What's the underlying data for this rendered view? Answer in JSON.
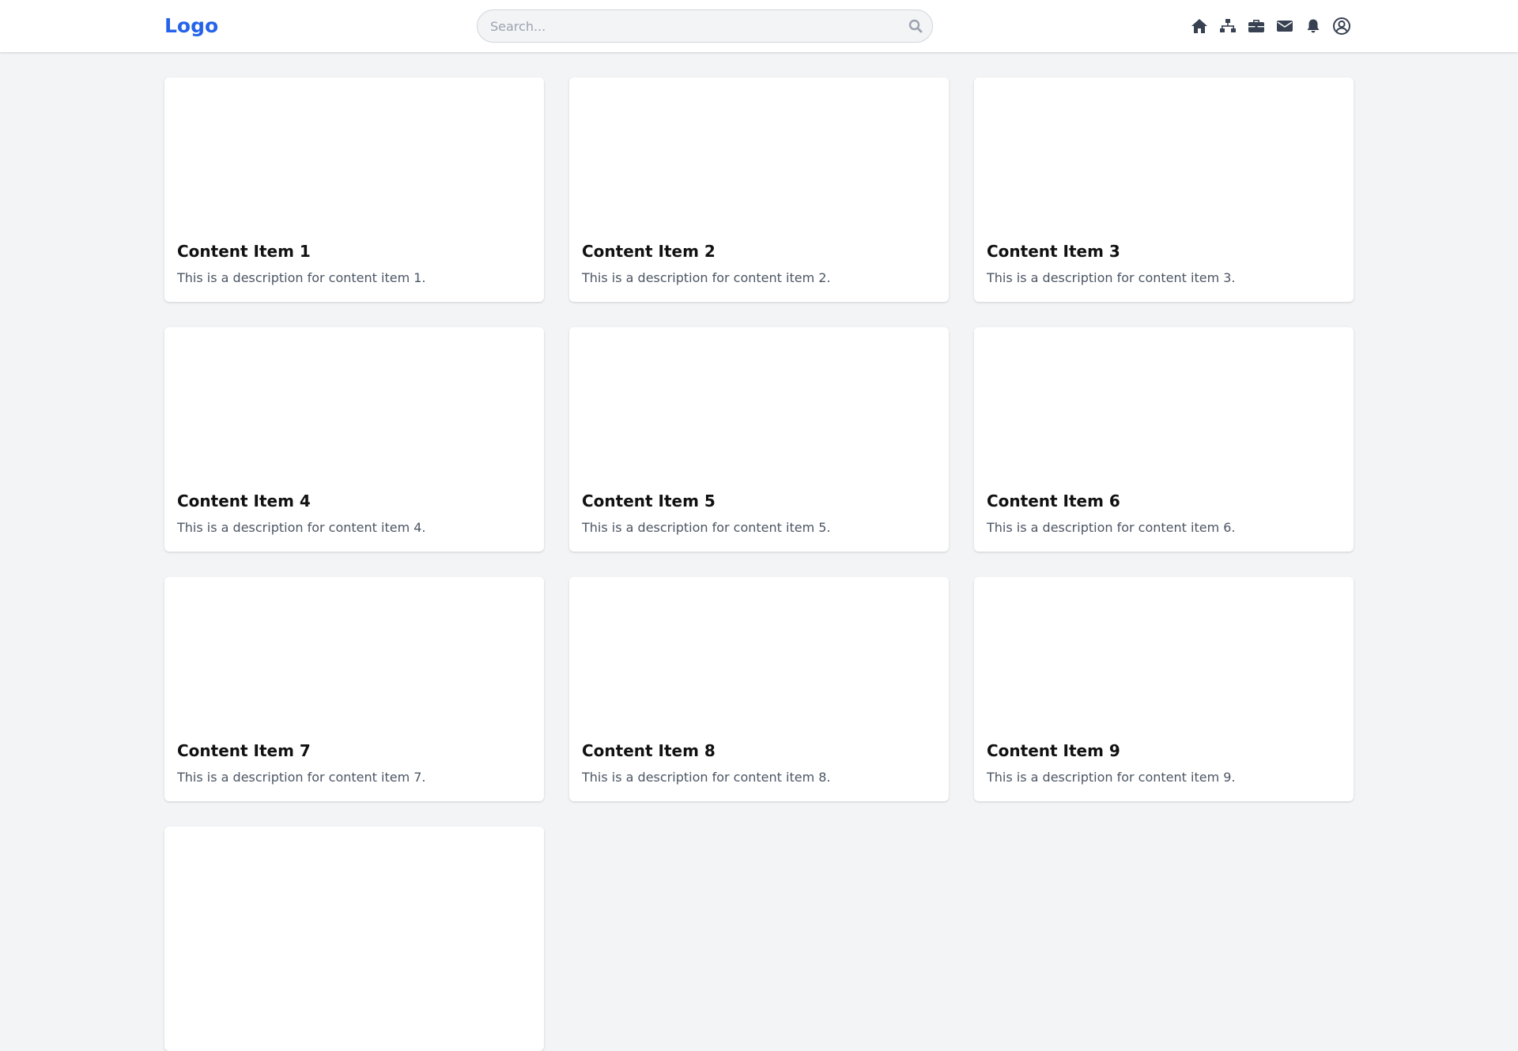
{
  "header": {
    "logo": "Logo",
    "search": {
      "placeholder": "Search...",
      "value": "",
      "icon": "search-icon"
    },
    "nav_icons": [
      {
        "name": "home-icon"
      },
      {
        "name": "sitemap-icon"
      },
      {
        "name": "briefcase-icon"
      },
      {
        "name": "envelope-icon"
      },
      {
        "name": "bell-icon"
      },
      {
        "name": "user-circle-icon"
      }
    ],
    "icon_color": "#374151",
    "logo_color": "#2563eb"
  },
  "cards": [
    {
      "title": "Content Item 1",
      "description": "This is a description for content item 1."
    },
    {
      "title": "Content Item 2",
      "description": "This is a description for content item 2."
    },
    {
      "title": "Content Item 3",
      "description": "This is a description for content item 3."
    },
    {
      "title": "Content Item 4",
      "description": "This is a description for content item 4."
    },
    {
      "title": "Content Item 5",
      "description": "This is a description for content item 5."
    },
    {
      "title": "Content Item 6",
      "description": "This is a description for content item 6."
    },
    {
      "title": "Content Item 7",
      "description": "This is a description for content item 7."
    },
    {
      "title": "Content Item 8",
      "description": "This is a description for content item 8."
    },
    {
      "title": "Content Item 9",
      "description": "This is a description for content item 9."
    },
    {
      "title": "",
      "description": ""
    }
  ]
}
